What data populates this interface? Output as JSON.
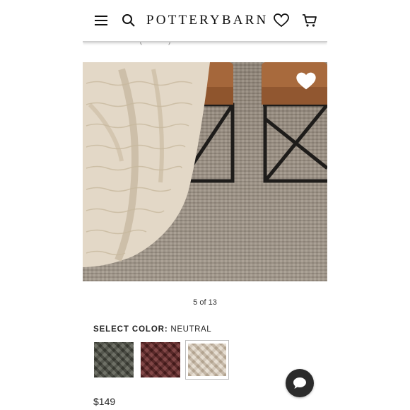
{
  "header": {
    "logo_text": "POTTERYBARN",
    "icons": [
      "menu-icon",
      "search-icon",
      "heart-icon",
      "cart-icon"
    ]
  },
  "gallery": {
    "counter": "5 of 13",
    "favorite_icon": "heart-outline-icon"
  },
  "color_selector": {
    "label": "SELECT COLOR:",
    "selected": "NEUTRAL",
    "swatches": [
      "green",
      "red",
      "neutral"
    ]
  },
  "product": {
    "price": "$149"
  },
  "chat": {
    "icon": "chat-bubble-icon"
  },
  "colors": {
    "accent": "#2b2b2b",
    "leather": "#a5673b"
  }
}
